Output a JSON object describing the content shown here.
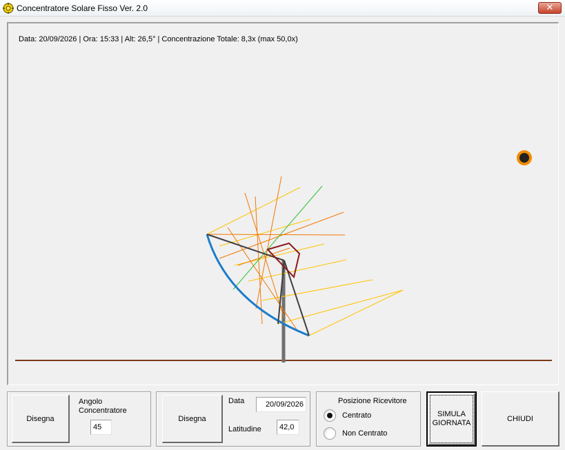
{
  "window": {
    "title": "Concentratore Solare Fisso Ver. 2.0",
    "close_symbol": "✕",
    "icon": "sun-gear-icon"
  },
  "status": {
    "text": "Data: 20/09/2026 | Ora: 15:33 | Alt: 26,5° | Concentrazione Totale: 8,3x (max 50,0x)"
  },
  "colors": {
    "reflector": "#1c7ccc",
    "frame": "#404040",
    "ground": "#7a3a18",
    "post": "#707070",
    "receiver": "#8b1a1a",
    "sun_ring": "#f08c00",
    "sun_core": "#222222",
    "ray_yellow": "#ffc400",
    "ray_orange": "#f07800",
    "ray_green": "#2ec22e"
  },
  "panel1": {
    "button_label": "Disegna",
    "angle_label": "Angolo Concentratore",
    "angle_value": "45"
  },
  "panel2": {
    "button_label": "Disegna",
    "date_label": "Data",
    "date_value": "20/09/2026",
    "latitude_label": "Latitudine",
    "latitude_value": "42,0"
  },
  "panel3": {
    "title": "Posizione Ricevitore",
    "options": [
      {
        "label": "Centrato",
        "selected": true
      },
      {
        "label": "Non Centrato",
        "selected": false
      }
    ]
  },
  "buttons": {
    "simulate_label": "SIMULA GIORNATA",
    "close_label": "CHIUDI"
  }
}
